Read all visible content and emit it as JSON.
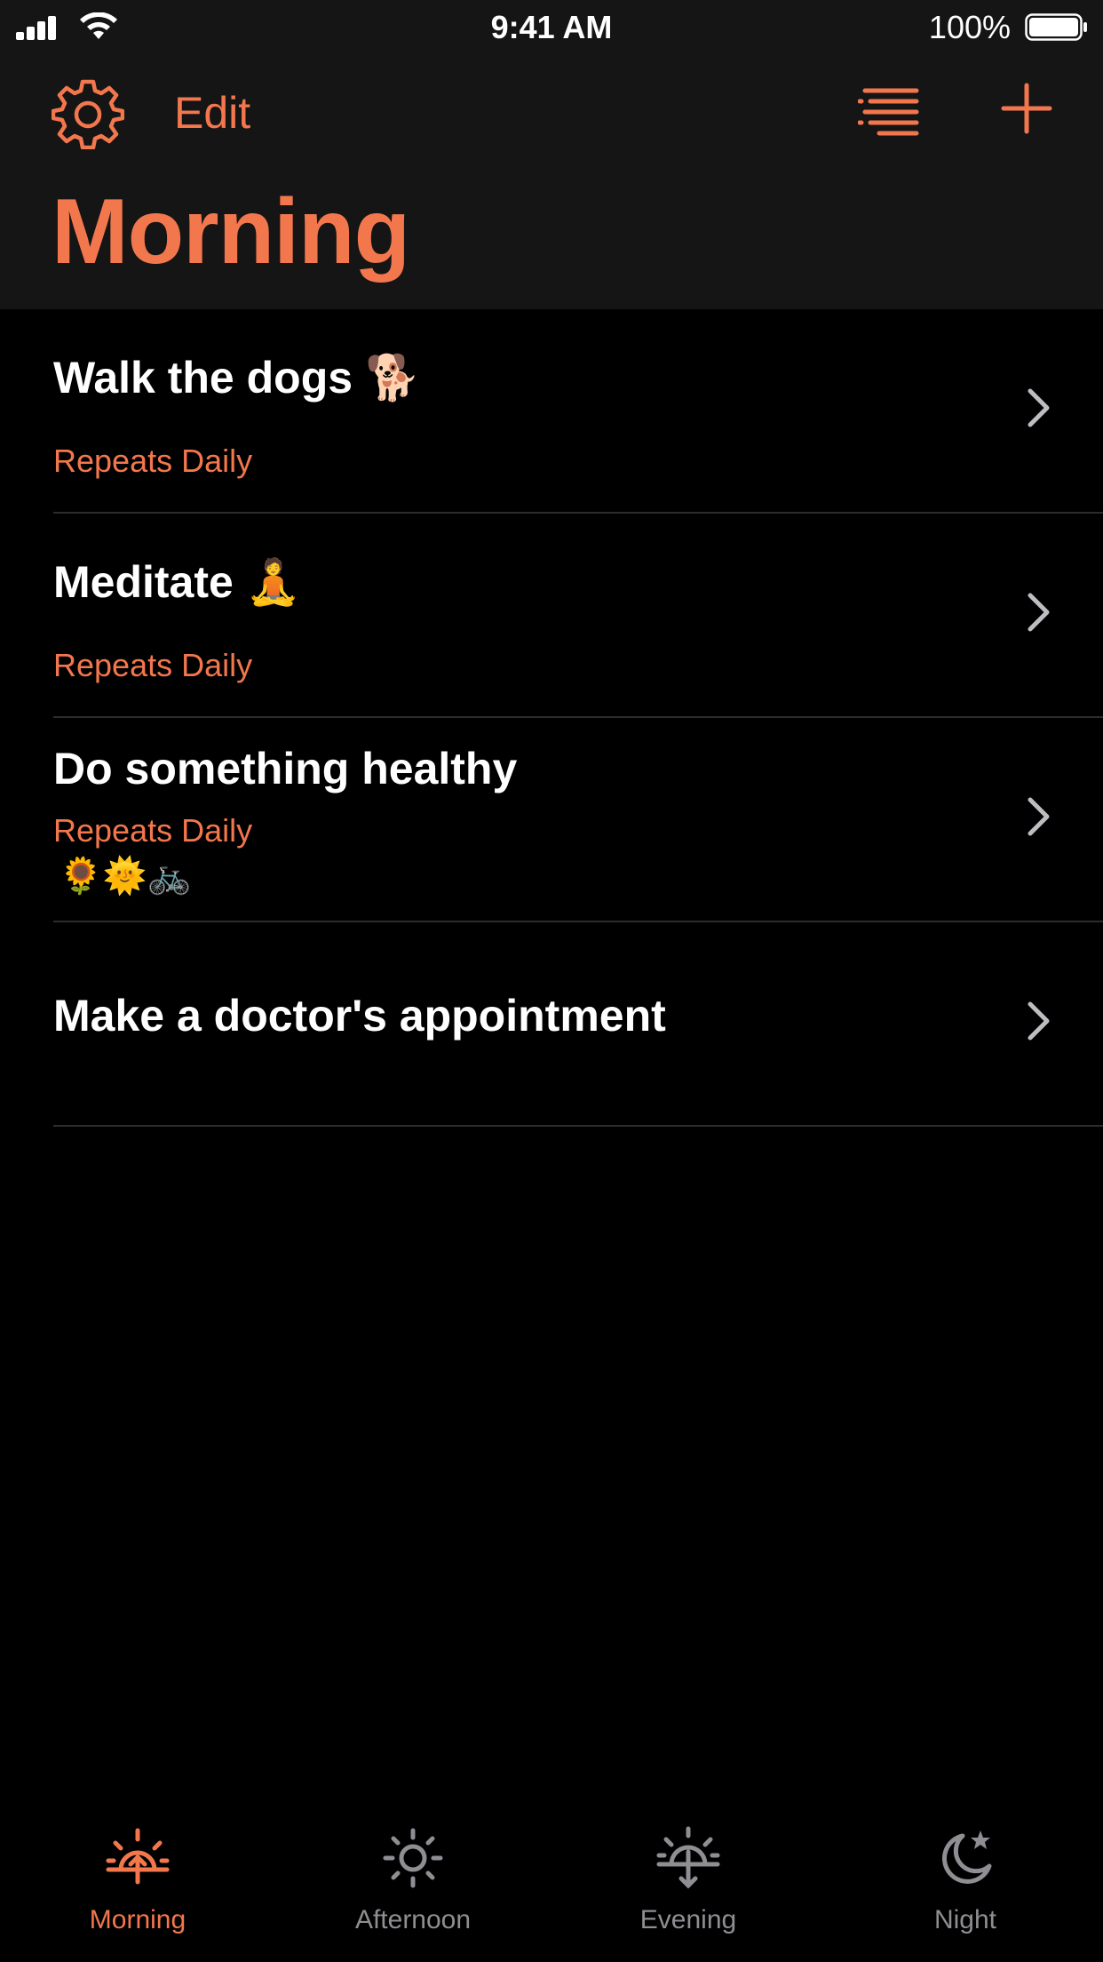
{
  "status_bar": {
    "time": "9:41 AM",
    "battery_percent": "100%"
  },
  "header": {
    "edit_label": "Edit",
    "title": "Morning"
  },
  "items": [
    {
      "title": "Walk the dogs 🐕",
      "subtitle": "Repeats Daily"
    },
    {
      "title": "Meditate 🧘",
      "subtitle": "Repeats Daily"
    },
    {
      "title": "Do something healthy",
      "subtitle": "Repeats Daily",
      "emojis": "🌻🌞🚲"
    },
    {
      "title": "Make a doctor's appointment"
    }
  ],
  "tabs": [
    {
      "label": "Morning",
      "selected": true
    },
    {
      "label": "Afternoon",
      "selected": false
    },
    {
      "label": "Evening",
      "selected": false
    },
    {
      "label": "Night",
      "selected": false
    }
  ],
  "colors": {
    "accent": "#f3774d",
    "inactive": "#8e8e93",
    "header_bg": "#151516",
    "background": "#000000"
  }
}
